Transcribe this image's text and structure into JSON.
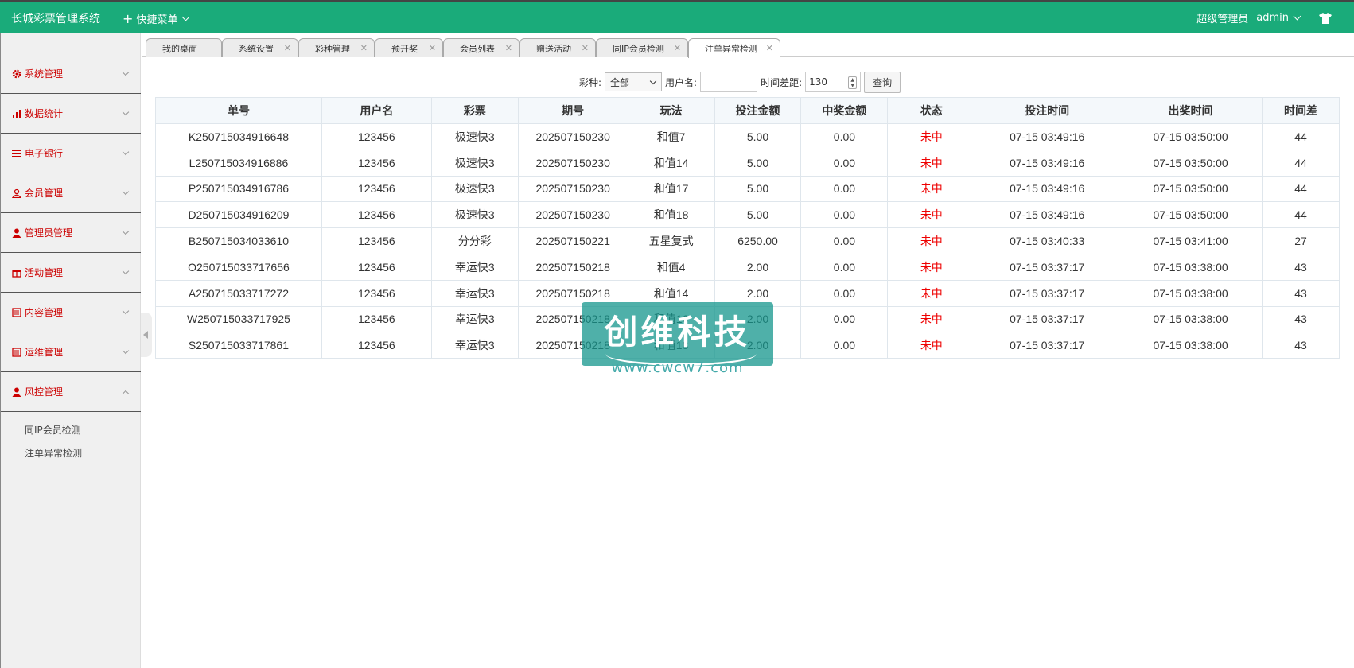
{
  "header": {
    "title": "长城彩票管理系统",
    "quick_menu": "快捷菜单",
    "role": "超级管理员",
    "username": "admin"
  },
  "sidebar": {
    "items": [
      {
        "label": "系统管理",
        "icon": "gear-icon"
      },
      {
        "label": "数据统计",
        "icon": "bar-chart-icon"
      },
      {
        "label": "电子银行",
        "icon": "list-icon"
      },
      {
        "label": "会员管理",
        "icon": "user-outline-icon"
      },
      {
        "label": "管理员管理",
        "icon": "user-icon"
      },
      {
        "label": "活动管理",
        "icon": "gift-icon"
      },
      {
        "label": "内容管理",
        "icon": "document-icon"
      },
      {
        "label": "运维管理",
        "icon": "document-icon"
      },
      {
        "label": "风控管理",
        "icon": "user-icon"
      }
    ],
    "sub_items": [
      "同IP会员检测",
      "注单异常检测"
    ]
  },
  "tabs": [
    {
      "label": "我的桌面"
    },
    {
      "label": "系统设置"
    },
    {
      "label": "彩种管理"
    },
    {
      "label": "预开奖"
    },
    {
      "label": "会员列表"
    },
    {
      "label": "赠送活动"
    },
    {
      "label": "同IP会员检测"
    },
    {
      "label": "注单异常检测"
    }
  ],
  "filter": {
    "lottery_label": "彩种:",
    "lottery_value": "全部",
    "username_label": "用户名:",
    "username_value": "",
    "timediff_label": "时间差距:",
    "timediff_value": "130",
    "query_button": "查询"
  },
  "table": {
    "headers": [
      "单号",
      "用户名",
      "彩票",
      "期号",
      "玩法",
      "投注金额",
      "中奖金额",
      "状态",
      "投注时间",
      "出奖时间",
      "时间差"
    ],
    "rows": [
      [
        "K250715034916648",
        "123456",
        "极速快3",
        "202507150230",
        "和值7",
        "5.00",
        "0.00",
        "未中",
        "07-15 03:49:16",
        "07-15 03:50:00",
        "44"
      ],
      [
        "L250715034916886",
        "123456",
        "极速快3",
        "202507150230",
        "和值14",
        "5.00",
        "0.00",
        "未中",
        "07-15 03:49:16",
        "07-15 03:50:00",
        "44"
      ],
      [
        "P250715034916786",
        "123456",
        "极速快3",
        "202507150230",
        "和值17",
        "5.00",
        "0.00",
        "未中",
        "07-15 03:49:16",
        "07-15 03:50:00",
        "44"
      ],
      [
        "D250715034916209",
        "123456",
        "极速快3",
        "202507150230",
        "和值18",
        "5.00",
        "0.00",
        "未中",
        "07-15 03:49:16",
        "07-15 03:50:00",
        "44"
      ],
      [
        "B250715034033610",
        "123456",
        "分分彩",
        "202507150221",
        "五星复式",
        "6250.00",
        "0.00",
        "未中",
        "07-15 03:40:33",
        "07-15 03:41:00",
        "27"
      ],
      [
        "O250715033717656",
        "123456",
        "幸运快3",
        "202507150218",
        "和值4",
        "2.00",
        "0.00",
        "未中",
        "07-15 03:37:17",
        "07-15 03:38:00",
        "43"
      ],
      [
        "A250715033717272",
        "123456",
        "幸运快3",
        "202507150218",
        "和值14",
        "2.00",
        "0.00",
        "未中",
        "07-15 03:37:17",
        "07-15 03:38:00",
        "43"
      ],
      [
        "W250715033717925",
        "123456",
        "幸运快3",
        "202507150218",
        "和值16",
        "2.00",
        "0.00",
        "未中",
        "07-15 03:37:17",
        "07-15 03:38:00",
        "43"
      ],
      [
        "S250715033717861",
        "123456",
        "幸运快3",
        "202507150218",
        "和值18",
        "2.00",
        "0.00",
        "未中",
        "07-15 03:37:17",
        "07-15 03:38:00",
        "43"
      ]
    ]
  },
  "watermark": {
    "title": "创维科技",
    "url": "www.cwcw7.com"
  },
  "colors": {
    "header_bg": "#1aab7a",
    "sidebar_text": "#cc0000",
    "status_red": "#ee0000"
  }
}
